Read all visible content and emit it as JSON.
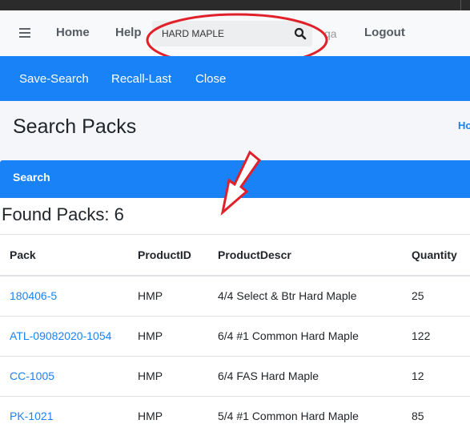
{
  "navbar": {
    "links": {
      "home": "Home",
      "help": "Help",
      "logout": "Logout"
    },
    "search": {
      "value": "HARD MAPLE"
    },
    "partial_text": "qa"
  },
  "actionbar": {
    "save_search": "Save-Search",
    "recall_last": "Recall-Last",
    "close": "Close"
  },
  "page": {
    "title": "Search Packs",
    "breadcrumb_home": "Ho"
  },
  "card": {
    "header": "Search"
  },
  "results": {
    "found_label": "Found Packs: 6",
    "columns": [
      "Pack",
      "ProductID",
      "ProductDescr",
      "Quantity"
    ],
    "rows": [
      {
        "pack": "180406-5",
        "product_id": "HMP",
        "descr": "4/4 Select & Btr Hard Maple",
        "qty": "25"
      },
      {
        "pack": "ATL-09082020-1054",
        "product_id": "HMP",
        "descr": "6/4 #1 Common Hard Maple",
        "qty": "122"
      },
      {
        "pack": "CC-1005",
        "product_id": "HMP",
        "descr": "6/4 FAS Hard Maple",
        "qty": "12"
      },
      {
        "pack": "PK-1021",
        "product_id": "HMP",
        "descr": "5/4 #1 Common Hard Maple",
        "qty": "85"
      }
    ]
  },
  "colors": {
    "primary": "#1a82f7",
    "annotation": "#e0202a"
  },
  "icons": {
    "menu": "hamburger-icon",
    "search": "magnifier-icon",
    "annotation_arrow": "arrow-down-left-icon"
  }
}
